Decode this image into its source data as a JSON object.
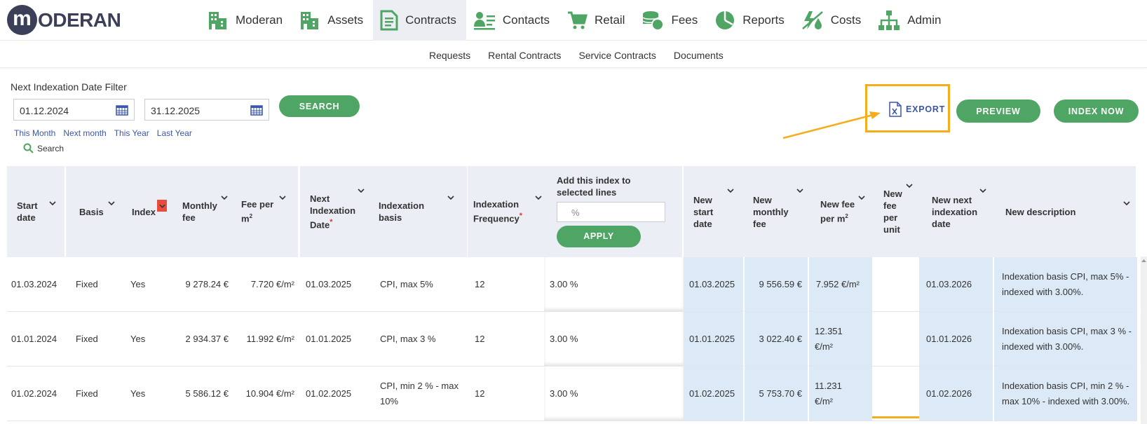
{
  "brand": {
    "logo_letter": "m",
    "logo_text": "ODERAN"
  },
  "nav": [
    {
      "label": "Moderan",
      "icon": "building-icon"
    },
    {
      "label": "Assets",
      "icon": "building-icon"
    },
    {
      "label": "Contracts",
      "icon": "document-icon",
      "active": true
    },
    {
      "label": "Contacts",
      "icon": "contact-card-icon"
    },
    {
      "label": "Retail",
      "icon": "cart-icon"
    },
    {
      "label": "Fees",
      "icon": "coins-icon"
    },
    {
      "label": "Reports",
      "icon": "pie-chart-icon"
    },
    {
      "label": "Costs",
      "icon": "energy-icon"
    },
    {
      "label": "Admin",
      "icon": "org-chart-icon"
    }
  ],
  "subnav": [
    "Requests",
    "Rental Contracts",
    "Service Contracts",
    "Documents"
  ],
  "filter": {
    "title": "Next Indexation Date Filter",
    "from": "01.12.2024",
    "to": "31.12.2025",
    "search_button": "SEARCH",
    "quick_links": [
      "This Month",
      "Next month",
      "This Year",
      "Last Year"
    ],
    "search_link": "Search"
  },
  "actions": {
    "export": "EXPORT",
    "preview": "PREVIEW",
    "index_now": "INDEX NOW"
  },
  "columns": {
    "start_date": "Start date",
    "basis": "Basis",
    "index": "Index",
    "monthly_fee": "Monthly fee",
    "fee_per": "Fee per m",
    "next_indexation": "Next Indexation Date",
    "indexation_basis": "Indexation basis",
    "indexation_frequency": "Indexation Frequency",
    "add_index": "Add this index to selected lines",
    "add_index_placeholder": "%",
    "apply": "APPLY",
    "new_start_date": "New start date",
    "new_monthly_fee": "New monthly fee",
    "new_fee_per": "New fee per m",
    "new_fee_per_unit": "New fee per unit",
    "new_next_indexation": "New next indexation date",
    "new_description": "New description"
  },
  "rows": [
    {
      "start_date": "01.03.2024",
      "basis": "Fixed",
      "index": "Yes",
      "monthly_fee": "9 278.24 €",
      "fee_per_m2": "7.720 €/m²",
      "next_indexation": "01.03.2025",
      "indexation_basis": "CPI, max 5%",
      "frequency": "12",
      "pct": "3.00 %",
      "new_start_date": "01.03.2025",
      "new_monthly_fee": "9 556.59 €",
      "new_fee_per_m2": "7.952 €/m²",
      "new_fee_per_unit": "",
      "new_next_indexation": "01.03.2026",
      "new_description": "Indexation basis CPI, max 5% - indexed with 3.00%."
    },
    {
      "start_date": "01.01.2024",
      "basis": "Fixed",
      "index": "Yes",
      "monthly_fee": "2 934.37 €",
      "fee_per_m2": "11.992 €/m²",
      "next_indexation": "01.01.2025",
      "indexation_basis": "CPI, max 3 %",
      "frequency": "12",
      "pct": "3.00 %",
      "new_start_date": "01.01.2025",
      "new_monthly_fee": "3 022.40 €",
      "new_fee_per_m2": "12.351 €/m²",
      "new_fee_per_unit": "",
      "new_next_indexation": "01.01.2026",
      "new_description": "Indexation basis CPI, max 3 % - indexed with 3.00%."
    },
    {
      "start_date": "01.02.2024",
      "basis": "Fixed",
      "index": "Yes",
      "monthly_fee": "5 586.12 €",
      "fee_per_m2": "10.904 €/m²",
      "next_indexation": "01.02.2025",
      "indexation_basis": "CPI, min 2 % - max 10%",
      "frequency": "12",
      "pct": "3.00 %",
      "new_start_date": "01.02.2025",
      "new_monthly_fee": "5 753.70 €",
      "new_fee_per_m2": "11.231 €/m²",
      "new_fee_per_unit": "",
      "new_next_indexation": "01.02.2026",
      "new_description": "Indexation basis CPI, min 2 % - max 10% - indexed with 3.00%."
    }
  ],
  "colors": {
    "green": "#4fa564",
    "highlight": "#f5ad1b",
    "header_bg": "#eceef5",
    "new_value_bg": "#dceaf7",
    "link": "#3a57a8"
  }
}
